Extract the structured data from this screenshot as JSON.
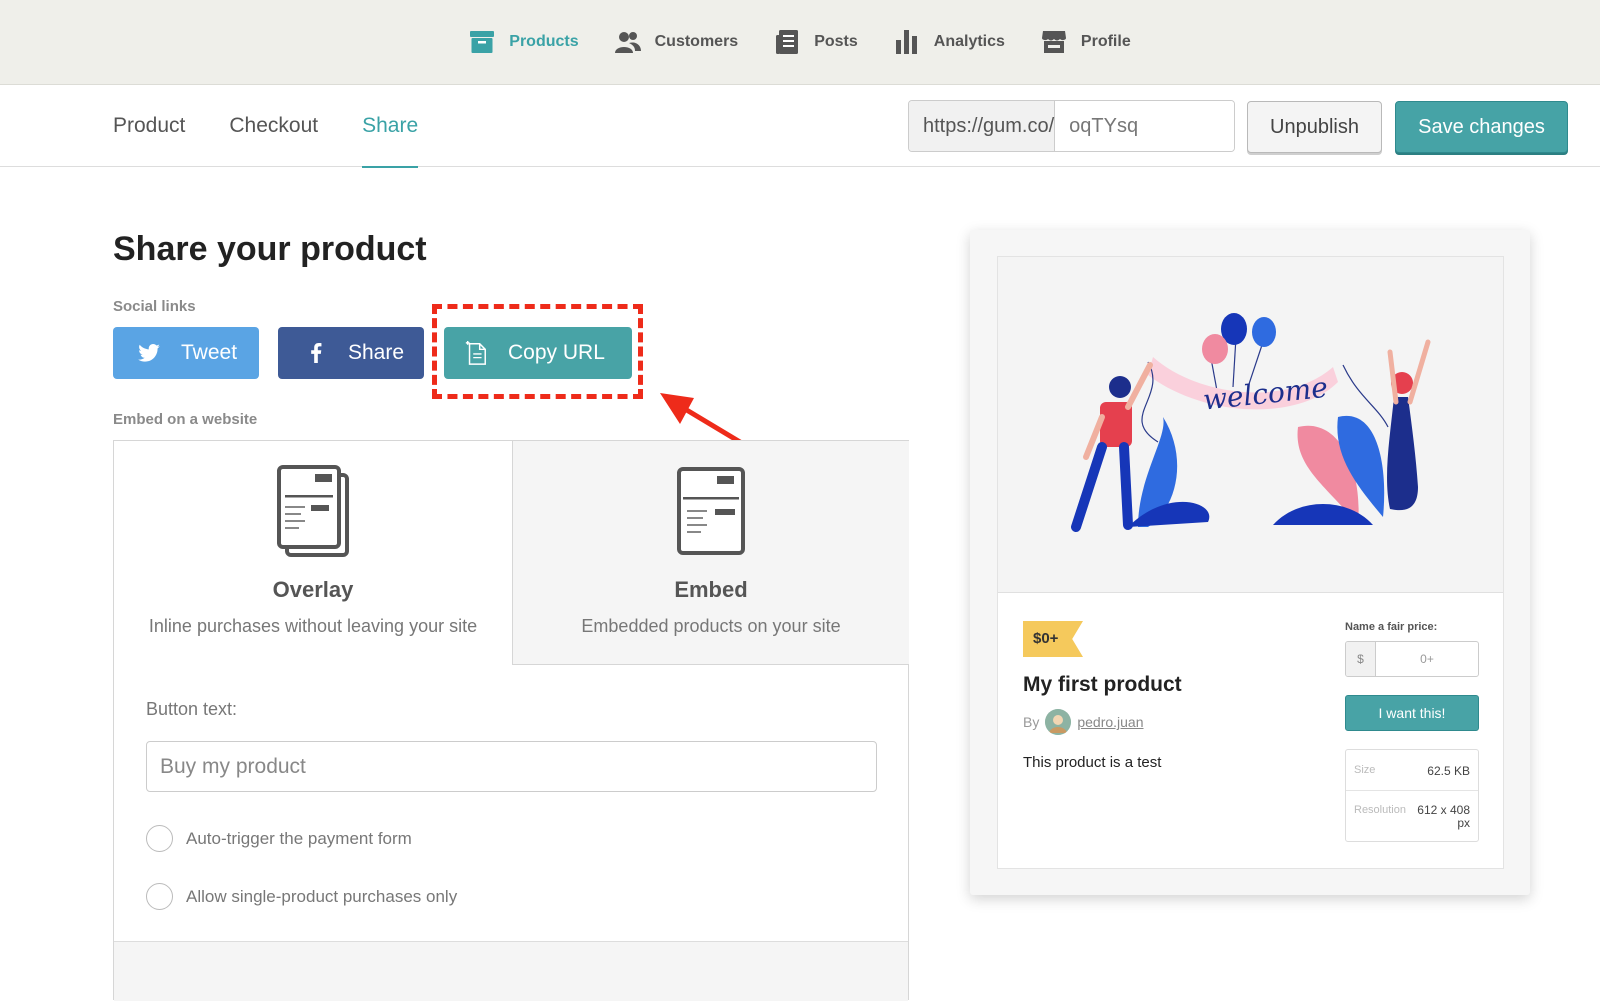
{
  "topnav": {
    "items": [
      {
        "label": "Products",
        "icon": "archive-box-icon",
        "active": true
      },
      {
        "label": "Customers",
        "icon": "people-icon"
      },
      {
        "label": "Posts",
        "icon": "newspaper-icon"
      },
      {
        "label": "Analytics",
        "icon": "bar-chart-icon"
      },
      {
        "label": "Profile",
        "icon": "storefront-icon"
      }
    ]
  },
  "subheader": {
    "tabs": [
      {
        "label": "Product"
      },
      {
        "label": "Checkout"
      },
      {
        "label": "Share",
        "active": true
      }
    ],
    "url_prefix": "https://gum.co/",
    "url_slug": "oqTYsq",
    "unpublish_label": "Unpublish",
    "save_label": "Save changes"
  },
  "main": {
    "title": "Share your product",
    "social_label": "Social links",
    "tweet_label": "Tweet",
    "share_label": "Share",
    "copy_label": "Copy URL",
    "embed_label": "Embed on a website",
    "options": [
      {
        "name": "Overlay",
        "desc": "Inline purchases without leaving your site"
      },
      {
        "name": "Embed",
        "desc": "Embedded products on your site"
      }
    ],
    "button_text_label": "Button text:",
    "button_text_placeholder": "Buy my product",
    "radio_auto": "Auto-trigger the payment form",
    "radio_single": "Allow single-product purchases only"
  },
  "preview": {
    "banner_text": "welcome",
    "price": "$0+",
    "product_name": "My first product",
    "by": "By",
    "author": "pedro.juan",
    "description": "This product is a test",
    "fair_price_label": "Name a fair price:",
    "currency": "$",
    "price_placeholder": "0+",
    "want_label": "I want this!",
    "size_key": "Size",
    "size_val": "62.5 KB",
    "res_key": "Resolution",
    "res_val": "612 x 408 px"
  },
  "colors": {
    "accent": "#46a3a6",
    "twitter": "#5aa4e4",
    "facebook": "#3e5a96",
    "highlight": "#ee2b1a",
    "price_tag": "#f5c95c"
  }
}
